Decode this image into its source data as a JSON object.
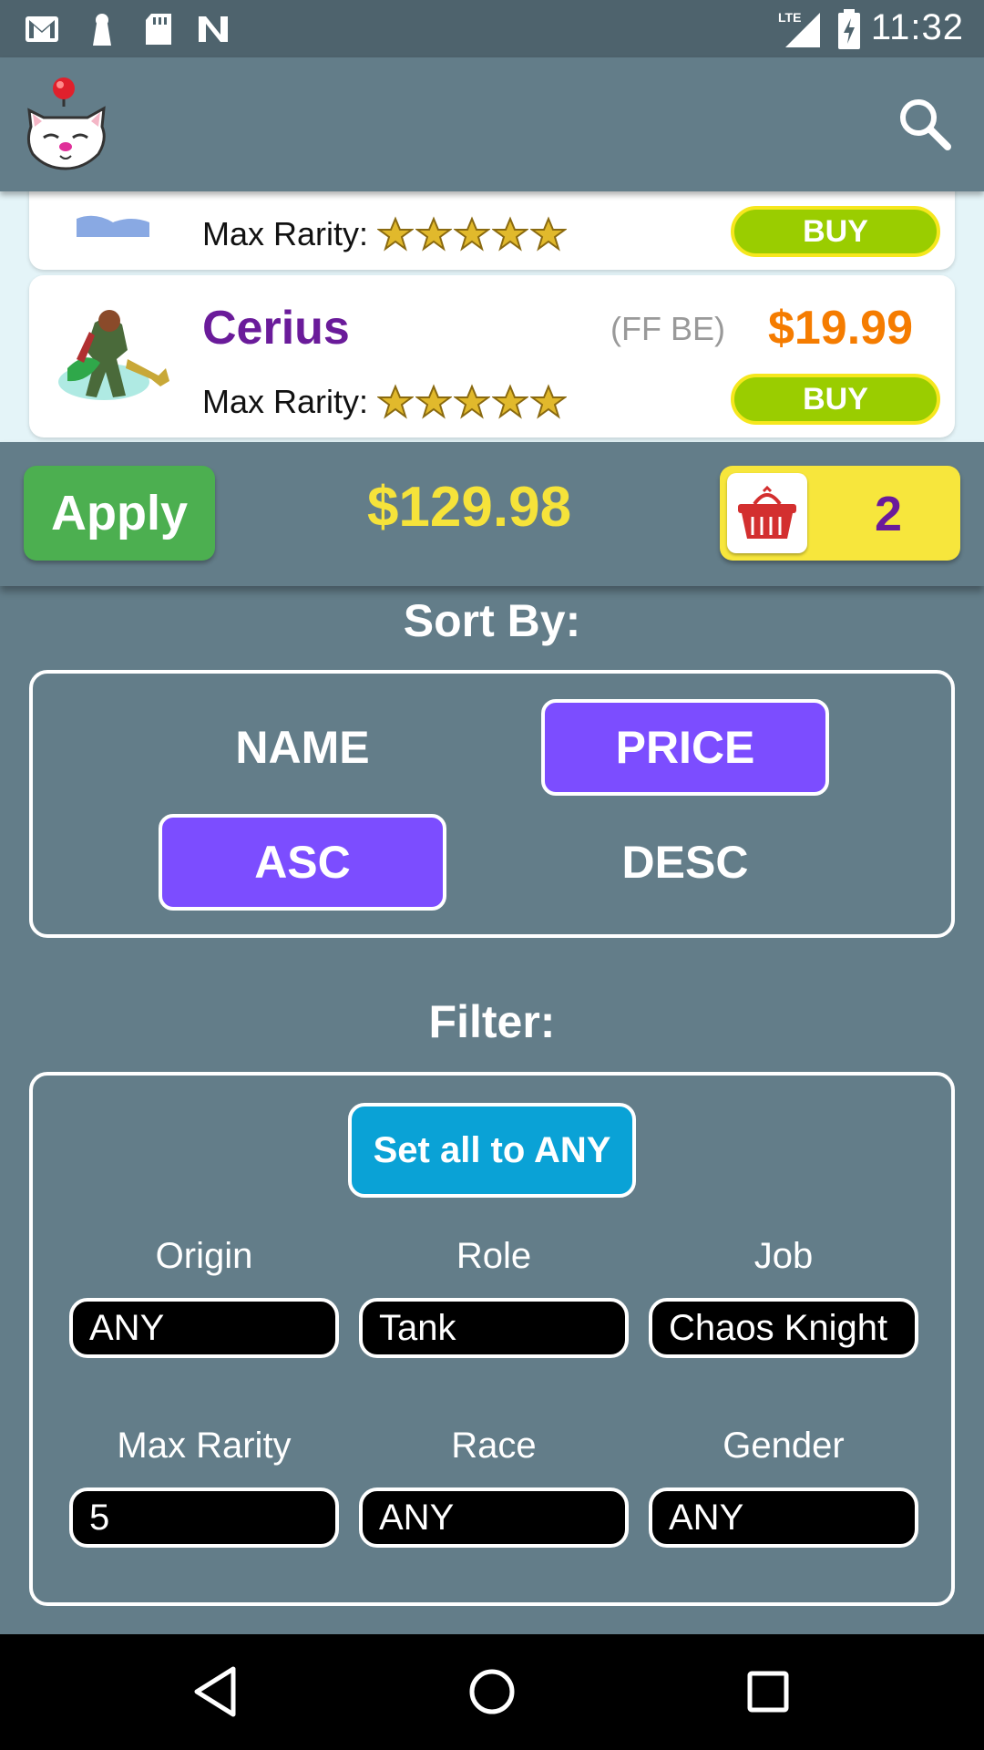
{
  "status_bar": {
    "time": "11:32",
    "network": "LTE",
    "icons": [
      "gmail-icon",
      "keyhole-icon",
      "sd-card-icon",
      "n-app-icon",
      "signal-icon",
      "battery-charging-icon"
    ]
  },
  "app_bar": {
    "logo_icon": "moogle-logo-icon",
    "search_icon": "search-icon"
  },
  "units": [
    {
      "name": "",
      "source": "",
      "price": "",
      "rarity_label": "Max Rarity:",
      "rarity": 5,
      "buy_label": "BUY",
      "partial": true
    },
    {
      "name": "Cerius",
      "source": "(FF BE)",
      "price": "$19.99",
      "rarity_label": "Max Rarity:",
      "rarity": 5,
      "buy_label": "BUY",
      "partial": false
    }
  ],
  "action_bar": {
    "apply_label": "Apply",
    "total": "$129.98",
    "cart_count": "2",
    "cart_icon": "basket-icon"
  },
  "sort": {
    "title": "Sort By:",
    "name_label": "NAME",
    "price_label": "PRICE",
    "asc_label": "ASC",
    "desc_label": "DESC",
    "selected_field": "PRICE",
    "selected_order": "ASC"
  },
  "filter": {
    "title": "Filter:",
    "set_all_label": "Set all to ANY",
    "origin": {
      "label": "Origin",
      "value": "ANY"
    },
    "role": {
      "label": "Role",
      "value": "Tank"
    },
    "job": {
      "label": "Job",
      "value": "Chaos Knight"
    },
    "max_rarity": {
      "label": "Max Rarity",
      "value": "5"
    },
    "race": {
      "label": "Race",
      "value": "ANY"
    },
    "gender": {
      "label": "Gender",
      "value": "ANY"
    }
  },
  "colors": {
    "primary": "#637d89",
    "accent_purple": "#7c4dff",
    "price_orange": "#f57c00",
    "total_yellow": "#f6e33a",
    "apply_green": "#4caf50",
    "buy_green": "#9acd00",
    "set_any_blue": "#0aa2d6"
  },
  "nav": {
    "back_icon": "back-triangle-icon",
    "home_icon": "home-circle-icon",
    "recents_icon": "recents-square-icon"
  }
}
